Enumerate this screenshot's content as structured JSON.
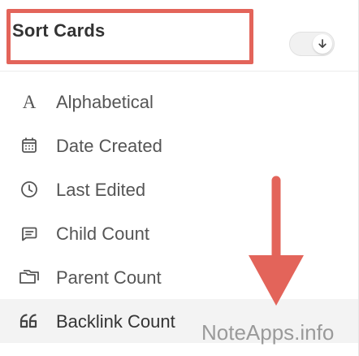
{
  "header": {
    "title": "Sort Cards",
    "sort_direction": "descending",
    "toggle_icon": "arrow-down-icon"
  },
  "menu": {
    "items": [
      {
        "label": "Alphabetical",
        "icon": "alphabet-a-icon",
        "active": false
      },
      {
        "label": "Date Created",
        "icon": "calendar-icon",
        "active": false
      },
      {
        "label": "Last Edited",
        "icon": "clock-icon",
        "active": false
      },
      {
        "label": "Child Count",
        "icon": "message-square-icon",
        "active": false
      },
      {
        "label": "Parent Count",
        "icon": "folder-icon",
        "active": false
      },
      {
        "label": "Backlink Count",
        "icon": "quote-icon",
        "active": true
      }
    ]
  },
  "annotations": {
    "highlight_color": "#e3645a",
    "arrow_color": "#e3645a"
  },
  "watermark": "NoteApps.info"
}
